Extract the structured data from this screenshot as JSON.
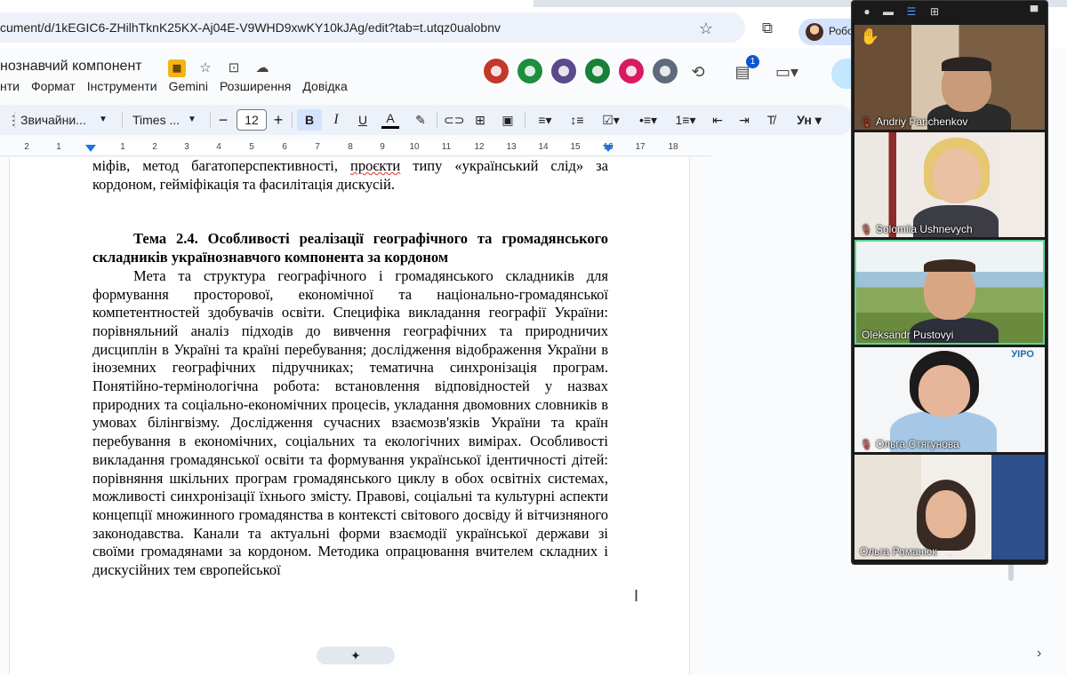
{
  "browser": {
    "url": "cument/d/1kEGIC6-ZHilhTknK25KX-Aj04E-V9WHD9xwKY10kJAg/edit?tab=t.utqz0ualobnv",
    "profile_label": "Робо"
  },
  "docs": {
    "title": "нознавчий компонент",
    "menu": [
      "нти",
      "Формат",
      "Інструменти",
      "Gemini",
      "Розширення",
      "Довідка"
    ],
    "comments_count": "1",
    "collaborators": [
      {
        "icon": "bear-icon",
        "color": "#c0392b"
      },
      {
        "icon": "squirrel-icon",
        "color": "#1e8e3e"
      },
      {
        "icon": "user-photo-icon",
        "color": "#5b4a8a"
      },
      {
        "icon": "apple-icon",
        "color": "#188038"
      },
      {
        "icon": "bird-icon",
        "color": "#d81b60"
      },
      {
        "icon": "user-group-icon",
        "color": "#5f6b7a"
      }
    ]
  },
  "toolbar": {
    "style": "Звичайни...",
    "font": "Times ...",
    "font_size": "12",
    "bold": "B",
    "italic": "I",
    "underline": "U",
    "font_color": "A",
    "input_tools": "Ун"
  },
  "ruler": {
    "labels": [
      "2",
      "1",
      "1",
      "2",
      "3",
      "4",
      "5",
      "6",
      "7",
      "8",
      "9",
      "10",
      "11",
      "12",
      "13",
      "14",
      "15",
      "16",
      "17",
      "18"
    ]
  },
  "document": {
    "para_top_1": "міфів, метод багатоперспективності, ",
    "para_top_spell": "проєкти",
    "para_top_2": " типу «український слід» за кордоном, гейміфікація та фасилітація дискусій.",
    "heading": "Тема 2.4. Особливості реалізації географічного та громадянського складників українознавчого компонента за кордоном",
    "paragraph": "Мета та структура географічного і громадянського складників для формування просторової, економічної та національно-громадянської компетентностей здобувачів освіти. Специфіка викладання географії України: порівняльний аналіз підходів до вивчення географічних та природничих дисциплін в Україні та країні перебування; дослідження відображення України в іноземних географічних підручниках; тематична синхронізація програм. Понятійно-термінологічна робота: встановлення відповідностей у назвах природних та соціально-економічних процесів, укладання двомовних словників в умовах білінгвізму. Дослідження сучасних взаємозв'язків України та країн перебування в економічних, соціальних та екологічних вимірах. Особливості викладання громадянської освіти та формування української ідентичності дітей: порівняння шкільних програм громадянського циклу в обох освітніх системах, можливості синхронізації їхнього змісту. Правові, соціальні та культурні аспекти концепції множинного громадянства в контексті світового досвіду й вітчизняного законодавства. Канали та актуальні форми взаємодії української держави зі своїми громадянами за кордоном. Методика опрацювання вчителем складних і дискусійних тем європейської"
  },
  "zoom": {
    "participants": [
      {
        "name": "Andriy Panchenkov",
        "muted": true
      },
      {
        "name": "Solomiia Ushnevych",
        "muted": true
      },
      {
        "name": "Oleksandr Pustovyi",
        "muted": false
      },
      {
        "name": "Ольга Стягунова",
        "muted": true
      },
      {
        "name": "Ольга Романюк",
        "muted": false
      }
    ],
    "tile4_logo": "УІРО"
  }
}
